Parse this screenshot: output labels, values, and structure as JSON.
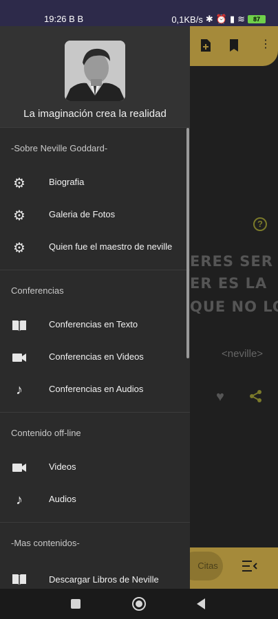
{
  "status_bar": {
    "time": "19:26",
    "extra_icons": "B  B",
    "network": "0,1KB/s",
    "battery": "87"
  },
  "app": {
    "toolbar_icons": [
      "add-document-icon",
      "bookmark-icon",
      "more-vert-icon"
    ],
    "quote_lines": [
      "ERES SER",
      "ER ES LA",
      "QUE NO LO"
    ],
    "author": "<neville>",
    "bottom_nav_label": "Citas"
  },
  "drawer": {
    "header_title": "La imaginación crea la realidad",
    "sections": [
      {
        "title": "-Sobre Neville Goddard-",
        "items": [
          {
            "label": "Biografia",
            "icon": "gear-icon"
          },
          {
            "label": "Galeria de Fotos",
            "icon": "gear-icon"
          },
          {
            "label": "Quien fue el maestro de neville",
            "icon": "gear-icon"
          }
        ]
      },
      {
        "title": "Conferencias",
        "items": [
          {
            "label": "Conferencias en Texto",
            "icon": "book-icon"
          },
          {
            "label": "Conferencias en Videos",
            "icon": "videocam-icon"
          },
          {
            "label": "Conferencias en Audios",
            "icon": "music-note-icon"
          }
        ]
      },
      {
        "title": "Contenido off-line",
        "items": [
          {
            "label": "Videos",
            "icon": "videocam-icon"
          },
          {
            "label": "Audios",
            "icon": "music-note-icon"
          }
        ]
      },
      {
        "title": "-Mas contenidos-",
        "items": [
          {
            "label": "Descargar Libros de Neville",
            "icon": "book-icon"
          },
          {
            "label": "",
            "icon": "music-note-icon"
          }
        ]
      }
    ]
  }
}
